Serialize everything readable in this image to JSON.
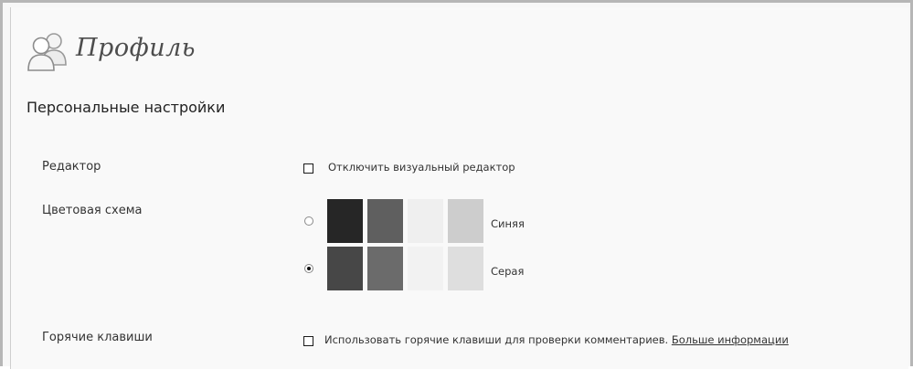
{
  "page": {
    "title": "Профиль",
    "icon": "users-icon"
  },
  "section": {
    "title": "Персональные настройки"
  },
  "editor": {
    "label": "Редактор",
    "checkbox_label": "Отключить визуальный редактор",
    "checked": false
  },
  "color_scheme": {
    "label": "Цветовая схема",
    "options": [
      {
        "name": "Синяя",
        "selected": false,
        "swatches": [
          "#262626",
          "#5f5f5f",
          "#efefef",
          "#cdcdcd"
        ]
      },
      {
        "name": "Серая",
        "selected": true,
        "swatches": [
          "#474747",
          "#6b6b6b",
          "#f2f2f2",
          "#dedede"
        ]
      }
    ]
  },
  "hotkeys": {
    "label": "Горячие клавиши",
    "checkbox_label": "Использовать горячие клавиши для проверки комментариев.",
    "link_text": "Больше информации",
    "checked": false
  }
}
